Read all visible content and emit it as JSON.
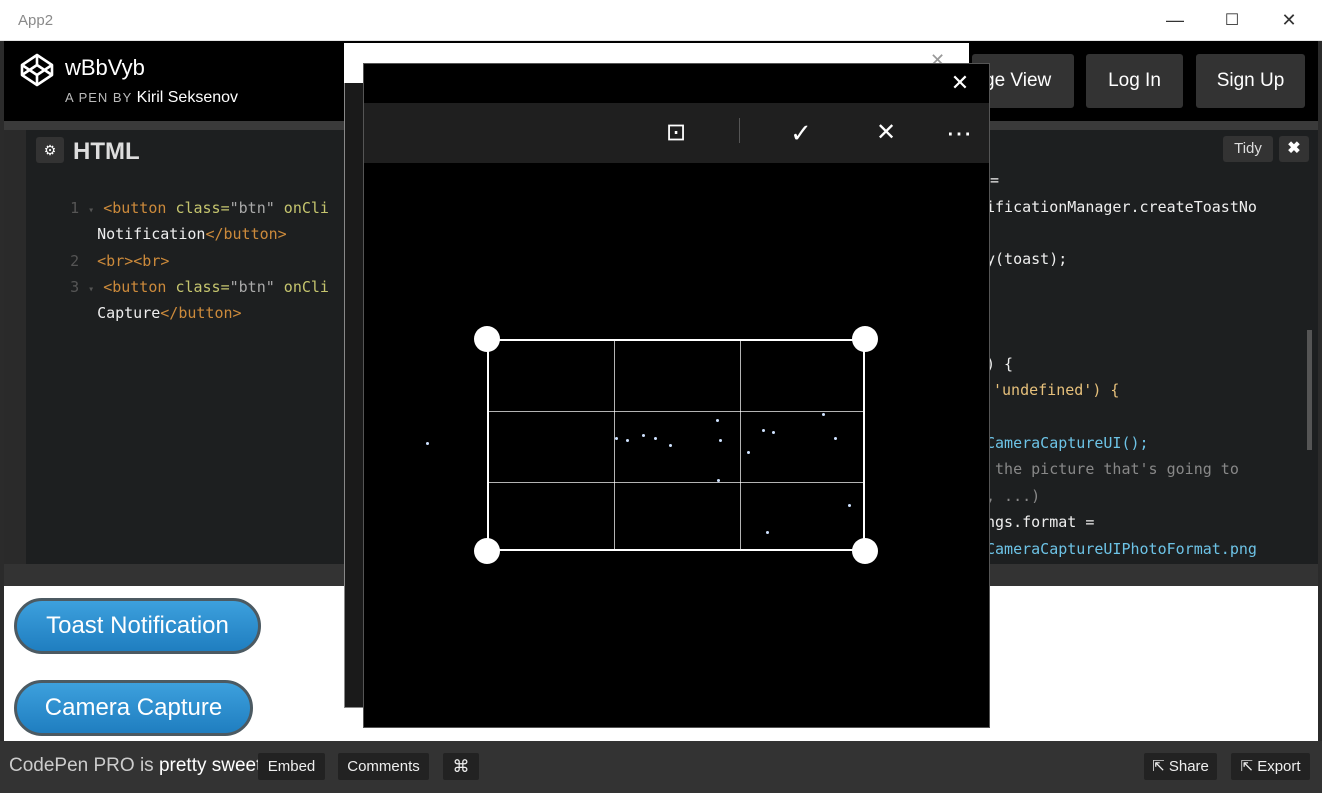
{
  "window": {
    "title": "App2",
    "minimize": "—",
    "maximize": "☐",
    "close": "✕"
  },
  "header": {
    "pen_title": "wBbVyb",
    "by_prefix": "A PEN BY",
    "author": "Kiril Seksenov",
    "buttons": {
      "page_view": "ge View",
      "log_in": "Log In",
      "sign_up": "Sign Up"
    }
  },
  "html_editor": {
    "label": "HTML",
    "gear": "⚙",
    "lines": [
      {
        "num": "1",
        "fold": "▾",
        "tag_open": "<button ",
        "attr": "class=",
        "str": "\"btn\"",
        "rest": " onCli"
      },
      {
        "num": "",
        "fold": "",
        "text": "Notification",
        "tag_close": "</button>"
      },
      {
        "num": "2",
        "fold": "",
        "text": "<br><br>"
      },
      {
        "num": "3",
        "fold": "▾",
        "tag_open": "<button ",
        "attr": "class=",
        "str": "\"btn\"",
        "rest": " onCli"
      },
      {
        "num": "",
        "fold": "",
        "text": "Capture",
        "tag_close": "</button>"
      }
    ]
  },
  "js_editor": {
    "tidy": "Tidy",
    "close": "✖",
    "lines": [
      "=",
      "ificationManager.createToastNo",
      "",
      "y(toast);",
      "",
      "",
      "",
      ") {",
      "'undefined') {",
      "",
      "CameraCaptureUI();",
      " the picture that's going to",
      ", ...)",
      "ngs.format =",
      "CameraCaptureUIPhotoFormat.png"
    ]
  },
  "result": {
    "toast_button": "Toast Notification",
    "camera_button": "Camera Capture"
  },
  "footer": {
    "pro_prefix": "CodePen PRO is",
    "pro_suffix": "pretty sweet.",
    "embed": "Embed",
    "comments": "Comments",
    "cmd": "⌘",
    "share": "Share",
    "export": "Export"
  },
  "camera_dialog": {
    "close": "✕",
    "tools": {
      "aspect": "⊡",
      "accept": "✓",
      "cancel": "✕",
      "more": "⋯"
    }
  },
  "colors": {
    "accent_blue": "#2a8fd3",
    "dark": "#1d1f20"
  }
}
